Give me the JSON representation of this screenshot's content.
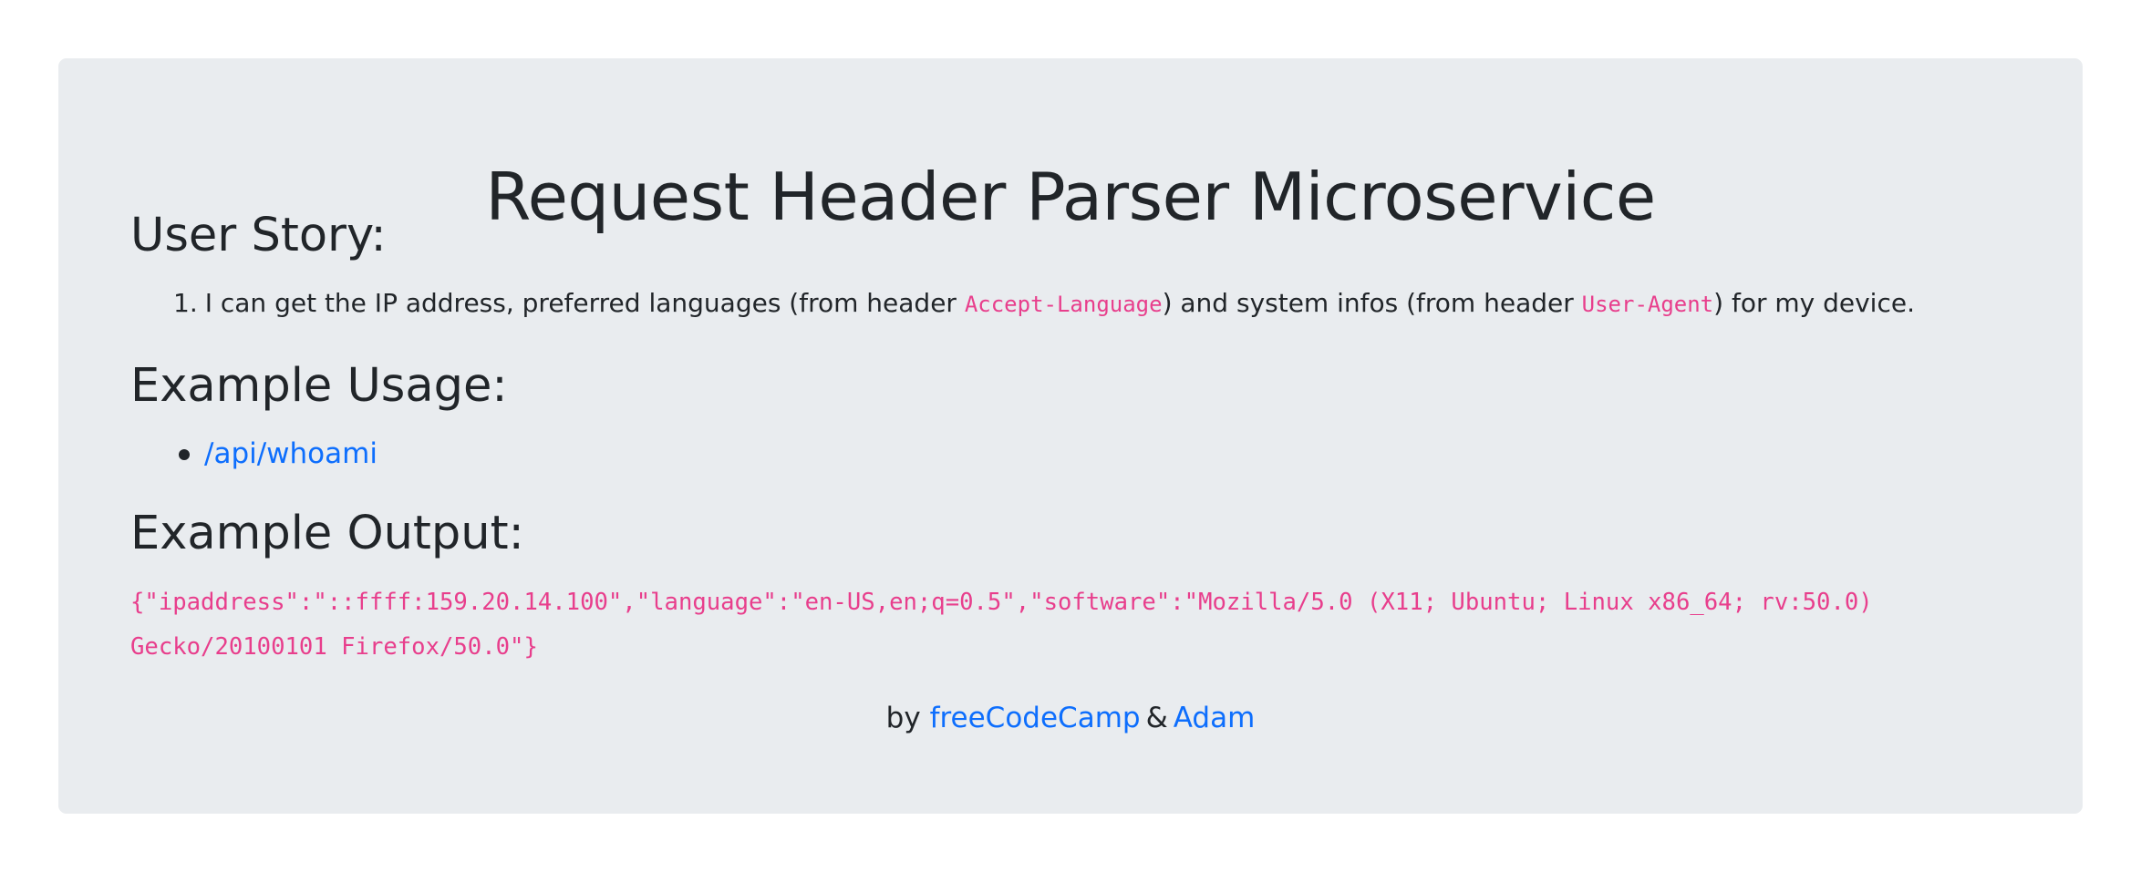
{
  "page": {
    "title": "Request Header Parser Microservice"
  },
  "user_story": {
    "heading": "User Story:",
    "item_number": "1.",
    "text_1": "I can get the IP address, preferred languages (from header ",
    "code_1": "Accept-Language",
    "text_2": ") and system infos (from header ",
    "code_2": "User-Agent",
    "text_3": ") for my device."
  },
  "example_usage": {
    "heading": "Example Usage:",
    "link_label": "/api/whoami"
  },
  "example_output": {
    "heading": "Example Output:",
    "line_1": "{\"ipaddress\":\"::ffff:159.20.14.100\",\"language\":\"en-US,en;q=0.5\",\"software\":\"Mozilla/5.0 (X11; Ubuntu; Linux x86_64; rv:50.0)",
    "line_2": "Gecko/20100101 Firefox/50.0\"}"
  },
  "footer": {
    "by": "by",
    "link_1": "freeCodeCamp",
    "ampersand": "&",
    "link_2": "Adam"
  },
  "colors": {
    "background": "#e9ecef",
    "text": "#212529",
    "code": "#e83e8c",
    "link": "#0d6efd"
  }
}
